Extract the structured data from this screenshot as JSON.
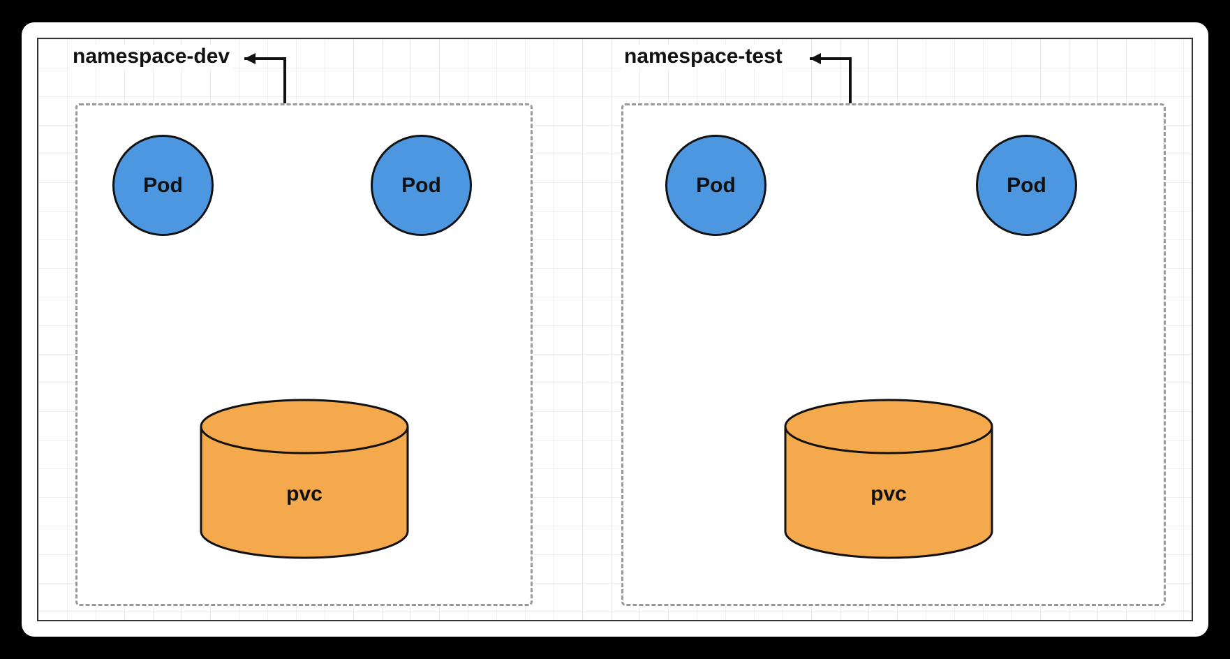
{
  "namespaces": [
    {
      "label": "namespace-dev",
      "pods": [
        "Pod",
        "Pod"
      ],
      "storage": "pvc"
    },
    {
      "label": "namespace-test",
      "pods": [
        "Pod",
        "Pod"
      ],
      "storage": "pvc"
    }
  ],
  "colors": {
    "pod_fill": "#4d97e0",
    "pvc_fill": "#f4a94c",
    "border": "#111111",
    "dash": "#999999"
  }
}
